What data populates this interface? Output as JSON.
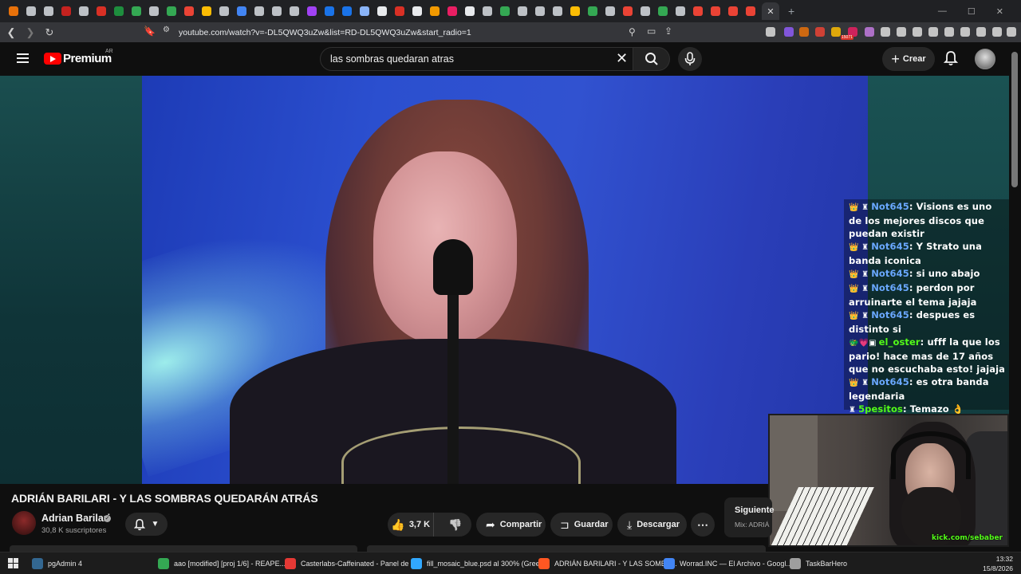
{
  "browser": {
    "url": "youtube.com/watch?v=-DL5QWQ3uZw&list=RD-DL5QWQ3uZw&start_radio=1",
    "active_tab_close": "✕",
    "tab_favicon_colors": [
      "#e8710a",
      "#bdc1c6",
      "#bdc1c6",
      "#c5221f",
      "#bdc1c6",
      "#d93025",
      "#1e8e3e",
      "#34a853",
      "#bdc1c6",
      "#34a853",
      "#ea4335",
      "#fbbc04",
      "#bdc1c6",
      "#4285f4",
      "#bdc1c6",
      "#bdc1c6",
      "#bdc1c6",
      "#a142f4",
      "#1a73e8",
      "#1a73e8",
      "#8ab4f8",
      "#e8eaed",
      "#d93025",
      "#e8eaed",
      "#f29900",
      "#e91e63",
      "#e8eaed",
      "#bdc1c6",
      "#34a853",
      "#bdc1c6",
      "#bdc1c6",
      "#bdc1c6",
      "#fbbc04",
      "#34a853",
      "#bdc1c6",
      "#ea4335",
      "#bdc1c6",
      "#34a853",
      "#bdc1c6",
      "#ea4335",
      "#ea4335",
      "#ea4335",
      "#ea4335",
      "#e8eaed"
    ],
    "ext_badge": "15071"
  },
  "youtube": {
    "logo_text": "Premium",
    "country": "AR",
    "search_value": "las sombras quedaran atras",
    "create_label": "Crear"
  },
  "chat": [
    {
      "badges": "👑 ♜",
      "user": "Not645",
      "user_color": "blue",
      "text": ": Visions es uno de los mejores discos que puedan existir"
    },
    {
      "badges": "👑 ♜",
      "user": "Not645",
      "user_color": "blue",
      "text": ": Y Strato una banda iconica"
    },
    {
      "badges": "👑 ♜",
      "user": "Not645",
      "user_color": "blue",
      "text": ": si uno abajo"
    },
    {
      "badges": "👑 ♜",
      "user": "Not645",
      "user_color": "blue",
      "text": ": perdon por arruinarte el tema jajaja"
    },
    {
      "badges": "👑 ♜",
      "user": "Not645",
      "user_color": "blue",
      "text": ": despues es distinto si"
    },
    {
      "badges": "🐲💗▣",
      "user": "el_oster",
      "user_color": "green",
      "text": ": ufff la que los pario! hace mas de 17 años que no escuchaba esto! jajaja"
    },
    {
      "badges": "👑 ♜",
      "user": "Not645",
      "user_color": "blue",
      "text": ": es otra banda legendaria"
    },
    {
      "badges": "♜",
      "user": "5pesitos",
      "user_color": "green",
      "text": ": Temazo 👌"
    }
  ],
  "cam_watermark": "kick.com/sebaber",
  "video": {
    "title": "ADRIÁN BARILARI - Y LAS SOMBRAS QUEDARÁN ATRÁS",
    "channel": "Adrian Barilari",
    "subscribers": "30,8 K suscriptores",
    "likes": "3,7 K",
    "share_label": "Compartir",
    "save_label": "Guardar",
    "download_label": "Descargar",
    "next_label": "Siguiente",
    "next_sub": "Mix: ADRIÁ"
  },
  "taskbar": {
    "items": [
      {
        "label": "pgAdmin 4",
        "icon_color": "#336791"
      },
      {
        "label": "aao [modified] [proj 1/6] - REAPE...",
        "icon_color": "#34a853"
      },
      {
        "label": "Casterlabs-Caffeinated - Panel de ...",
        "icon_color": "#e53935"
      },
      {
        "label": "fill_mosaic_blue.psd al 300% (Gree...",
        "icon_color": "#31a8ff"
      },
      {
        "label": "ADRIÁN BARILARI - Y LAS SOMBR...",
        "icon_color": "#ff5722"
      },
      {
        "label": "Worrad.INC — El Archivo - Googl...",
        "icon_color": "#4285f4"
      },
      {
        "label": "TaskBarHero",
        "icon_color": "#9e9e9e"
      }
    ],
    "time": "13:32",
    "date": "15/8/2026"
  }
}
